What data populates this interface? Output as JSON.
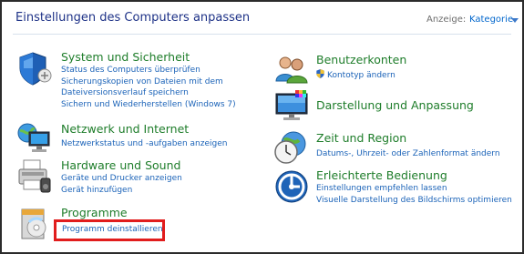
{
  "header": {
    "title": "Einstellungen des Computers anpassen",
    "view_label": "Anzeige:",
    "view_value": "Kategorie"
  },
  "categories_left": [
    {
      "title": "System und Sicherheit",
      "icon": "shield-icon",
      "links": [
        "Status des Computers überprüfen",
        "Sicherungskopien von Dateien mit dem",
        "Dateiversionsverlauf speichern",
        "Sichern und Wiederherstellen (Windows 7)"
      ]
    },
    {
      "title": "Netzwerk und Internet",
      "icon": "network-icon",
      "links": [
        "Netzwerkstatus und -aufgaben anzeigen"
      ]
    },
    {
      "title": "Hardware und Sound",
      "icon": "printer-icon",
      "links": [
        "Geräte und Drucker anzeigen",
        "Gerät hinzufügen"
      ]
    },
    {
      "title": "Programme",
      "icon": "programs-icon",
      "links": [
        "Programm deinstallieren"
      ]
    }
  ],
  "categories_right": [
    {
      "title": "Benutzerkonten",
      "icon": "users-icon",
      "links": [
        "Kontotyp ändern"
      ]
    },
    {
      "title": "Darstellung und Anpassung",
      "icon": "display-icon",
      "links": []
    },
    {
      "title": "Zeit und Region",
      "icon": "clock-icon",
      "links": [
        "Datums-, Uhrzeit- oder Zahlenformat ändern"
      ]
    },
    {
      "title": "Erleichterte Bedienung",
      "icon": "accessibility-icon",
      "links": [
        "Einstellungen empfehlen lassen",
        "Visuelle Darstellung des Bildschirms optimieren"
      ]
    }
  ],
  "colors": {
    "title_green": "#1e7d2a",
    "link_blue": "#1b63b8",
    "highlight_red": "#e11d1d"
  }
}
